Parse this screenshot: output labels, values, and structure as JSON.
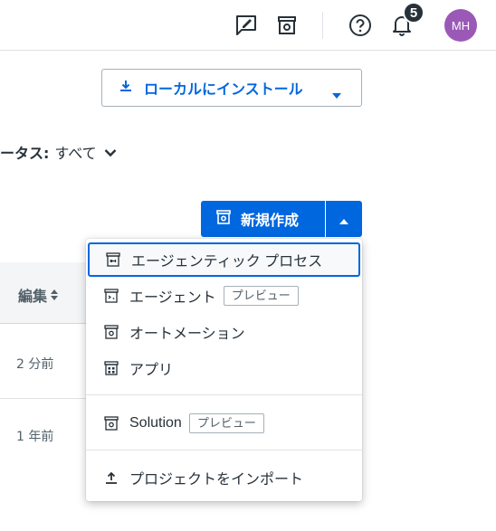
{
  "header": {
    "icons": [
      "feedback-icon",
      "store-icon",
      "help-icon",
      "bell-icon"
    ],
    "notification_count": "5",
    "avatar_initials": "MH",
    "avatar_color": "#9b59b6"
  },
  "install_button": {
    "label": "ローカルにインストール"
  },
  "status_filter": {
    "label": "ータス:",
    "value": "すべて"
  },
  "new_button": {
    "label": "新規作成"
  },
  "table": {
    "column_header": "編集",
    "rows": [
      "2 分前",
      "1 年前"
    ]
  },
  "menu": {
    "items": [
      {
        "label": "エージェンティック プロセス",
        "icon": "agentic-process-icon",
        "tag": ""
      },
      {
        "label": "エージェント",
        "icon": "agent-icon",
        "tag": "プレビュー"
      },
      {
        "label": "オートメーション",
        "icon": "automation-icon",
        "tag": ""
      },
      {
        "label": "アプリ",
        "icon": "app-icon",
        "tag": ""
      },
      {
        "label": "Solution",
        "icon": "solution-icon",
        "tag": "プレビュー"
      },
      {
        "label": "プロジェクトをインポート",
        "icon": "upload-icon",
        "tag": ""
      }
    ]
  },
  "colors": {
    "accent": "#0067df",
    "text": "#273139",
    "border": "#a4b1b8"
  }
}
